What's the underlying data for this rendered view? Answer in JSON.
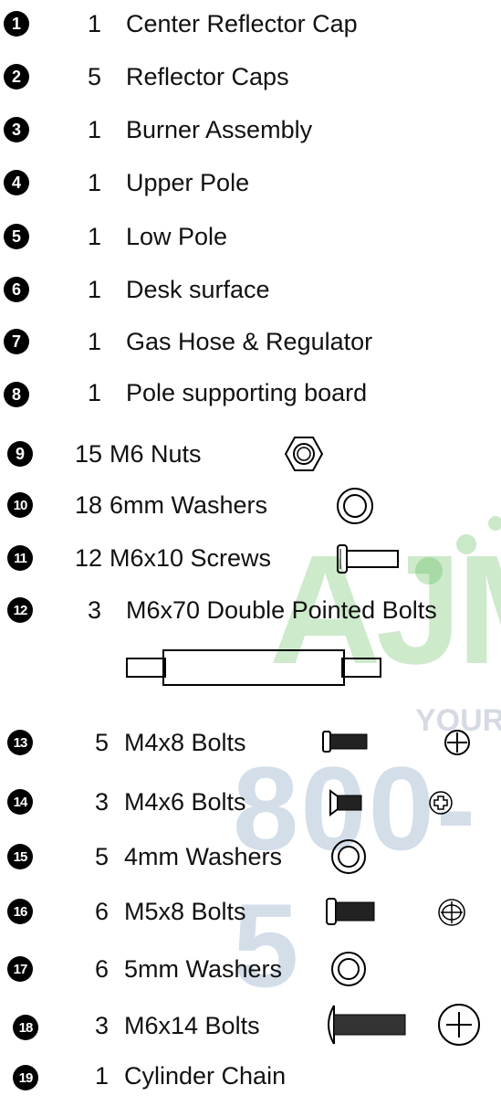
{
  "parts": [
    {
      "n": "1",
      "qty": "1",
      "desc": "Center Reflector Cap"
    },
    {
      "n": "2",
      "qty": "5",
      "desc": "Reflector Caps"
    },
    {
      "n": "3",
      "qty": "1",
      "desc": "Burner Assembly"
    },
    {
      "n": "4",
      "qty": "1",
      "desc": "Upper Pole"
    },
    {
      "n": "5",
      "qty": "1",
      "desc": "Low Pole"
    },
    {
      "n": "6",
      "qty": "1",
      "desc": "Desk surface"
    },
    {
      "n": "7",
      "qty": "1",
      "desc": "Gas Hose & Regulator"
    },
    {
      "n": "8",
      "qty": "1",
      "desc": "Pole supporting board"
    },
    {
      "n": "9",
      "qty": "15",
      "desc": "M6 Nuts"
    },
    {
      "n": "10",
      "qty": "18",
      "desc": "6mm Washers"
    },
    {
      "n": "11",
      "qty": "12",
      "desc": "M6x10 Screws"
    },
    {
      "n": "12",
      "qty": "3",
      "desc": "M6x70 Double Pointed Bolts"
    },
    {
      "n": "13",
      "qty": "5",
      "desc": "M4x8 Bolts"
    },
    {
      "n": "14",
      "qty": "3",
      "desc": "M4x6 Bolts"
    },
    {
      "n": "15",
      "qty": "5",
      "desc": "4mm Washers"
    },
    {
      "n": "16",
      "qty": "6",
      "desc": "M5x8 Bolts"
    },
    {
      "n": "17",
      "qty": "6",
      "desc": "5mm Washers"
    },
    {
      "n": "18",
      "qty": "3",
      "desc": "M6x14 Bolts"
    },
    {
      "n": "19",
      "qty": "1",
      "desc": "Cylinder Chain"
    }
  ],
  "watermark": {
    "brand": "AJM",
    "tagline": "YOUR",
    "phone": "800-5"
  }
}
